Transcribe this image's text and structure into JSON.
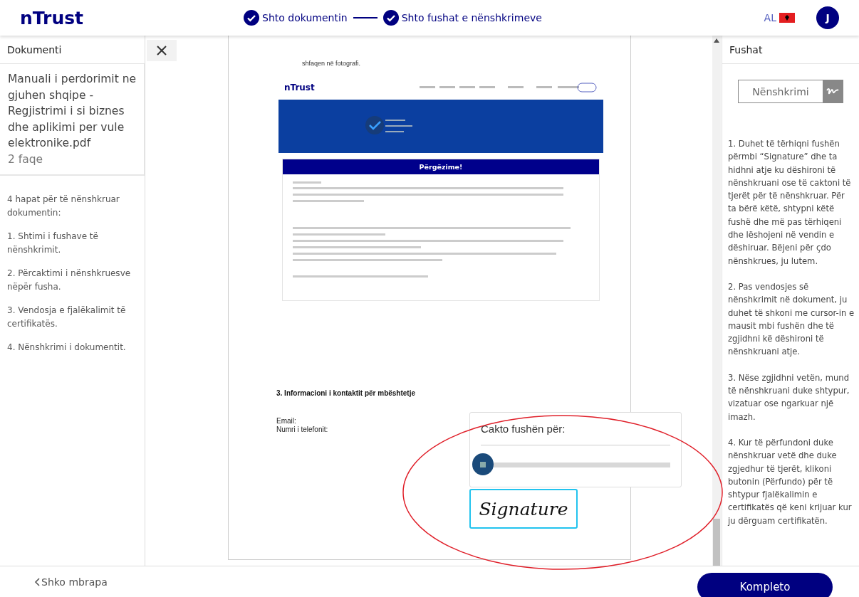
{
  "header": {
    "logo": "nTrust",
    "steps": [
      {
        "label": "Shto dokumentin",
        "done": true
      },
      {
        "label": "Shto fushat e nënshkrimeve",
        "done": true
      }
    ],
    "language": "AL",
    "avatar": "J"
  },
  "left_panel": {
    "title": "Dokumenti",
    "document": {
      "name": "Manuali i perdorimit ne gjuhen shqipe - Regjistrimi i si biznes dhe aplikimi per vule elektronike.pdf",
      "pages": "2 faqe"
    },
    "steps": [
      "4 hapat për të nënshkruar dokumentin:",
      "1. Shtimi i fushave të nënshkrimit.",
      "2. Përcaktimi i nënshkruesve nëpër fusha.",
      "3. Vendosja e fjalëkalimit të certifikatës.",
      "4. Nënshkrimi i dokumentit."
    ]
  },
  "document": {
    "top_text": "shfaqen në fotografi.",
    "embedded_email": {
      "logo": "nTrust",
      "heading": "Përgëzime!"
    },
    "section_title": "3. Informacioni i kontaktit për mbështetje",
    "contact_lines": [
      "Email:",
      "Numri i telefonit:"
    ],
    "assign_popup": {
      "title": "Cakto fushën për:"
    },
    "signature_field": {
      "text": "Signature",
      "selected": true
    }
  },
  "right_panel": {
    "title": "Fushat",
    "field_button": "Nënshkrimi",
    "instructions": [
      "1. Duhet të tërhiqni fushën përmbi “Signature” dhe ta hidhni atje ku dëshironi të nënshkruani ose të caktoni të tjerët për të nënshkruar. Për ta bërë këtë, shtypni këtë fushë dhe më pas tërhiqeni dhe lëshojeni në vendin e dëshiruar. Bëjeni për çdo nënshkrues, ju lutem.",
      "2. Pas vendosjes së nënshkrimit në dokument, ju duhet të shkoni me cursor-in e mausit mbi fushën dhe të zgjidhni kë dëshironi të nënshkruani atje.",
      "3. Nëse zgjidhni vetën, mund të nënshkruani duke shtypur, vizatuar ose ngarkuar një imazh.",
      "4. Kur të përfundoni duke nënshkruar vetë dhe duke zgjedhur të tjerët, klikoni butonin (Përfundo) për të shtypur fjalëkalimin e certifikatës që keni krijuar kur ju dërguam certifikatën."
    ]
  },
  "footer": {
    "back": "Shko mbrapa",
    "complete": "Kompleto"
  }
}
